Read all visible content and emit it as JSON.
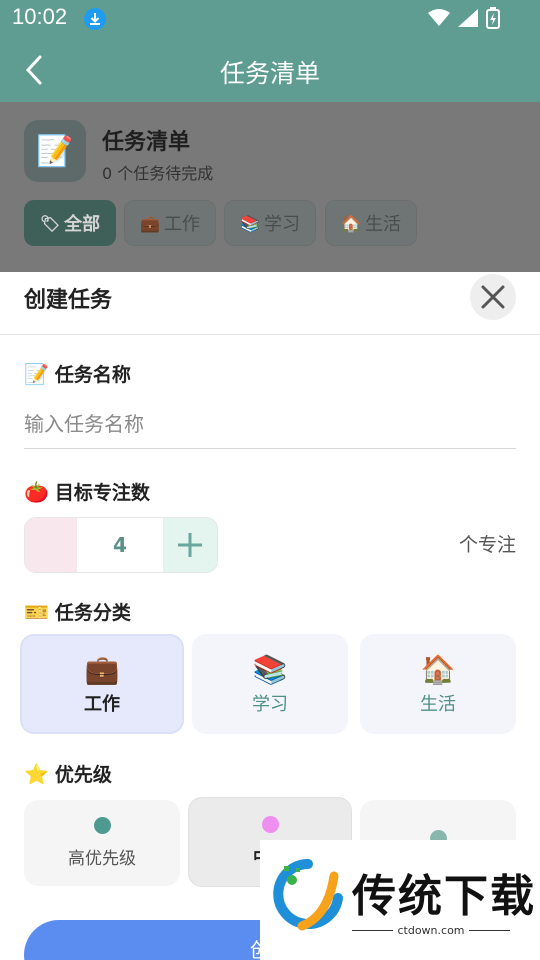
{
  "status_bar": {
    "time": "10:02"
  },
  "app_bar": {
    "title": "任务清单"
  },
  "task_list": {
    "title": "任务清单",
    "subtitle": "0 个任务待完成",
    "filters": [
      {
        "label": "全部",
        "icon": "tag-icon"
      },
      {
        "label": "工作",
        "icon": "briefcase-icon"
      },
      {
        "label": "学习",
        "icon": "books-icon"
      },
      {
        "label": "生活",
        "icon": "house-icon"
      }
    ]
  },
  "sheet": {
    "title": "创建任务",
    "name_section": {
      "label": "任务名称",
      "placeholder": "输入任务名称"
    },
    "focus_section": {
      "label": "目标专注数",
      "count": "4",
      "unit": "个专注"
    },
    "category_section": {
      "label": "任务分类",
      "options": [
        {
          "label": "工作",
          "selected": true
        },
        {
          "label": "学习",
          "selected": false
        },
        {
          "label": "生活",
          "selected": false
        }
      ]
    },
    "priority_section": {
      "label": "优先级",
      "options": [
        {
          "label": "高优先级",
          "color": "#4e9a90"
        },
        {
          "label": "中优",
          "color": "#ee8ff0"
        },
        {
          "label": "",
          "color": "#88b7ae"
        }
      ]
    },
    "create_button": "创建"
  },
  "watermark": {
    "brand": "传统下载",
    "url": "ctdown.com"
  },
  "colors": {
    "primary": "#5f9d92",
    "button": "#5b8cf0",
    "selected_bg": "#e6e9fb"
  }
}
